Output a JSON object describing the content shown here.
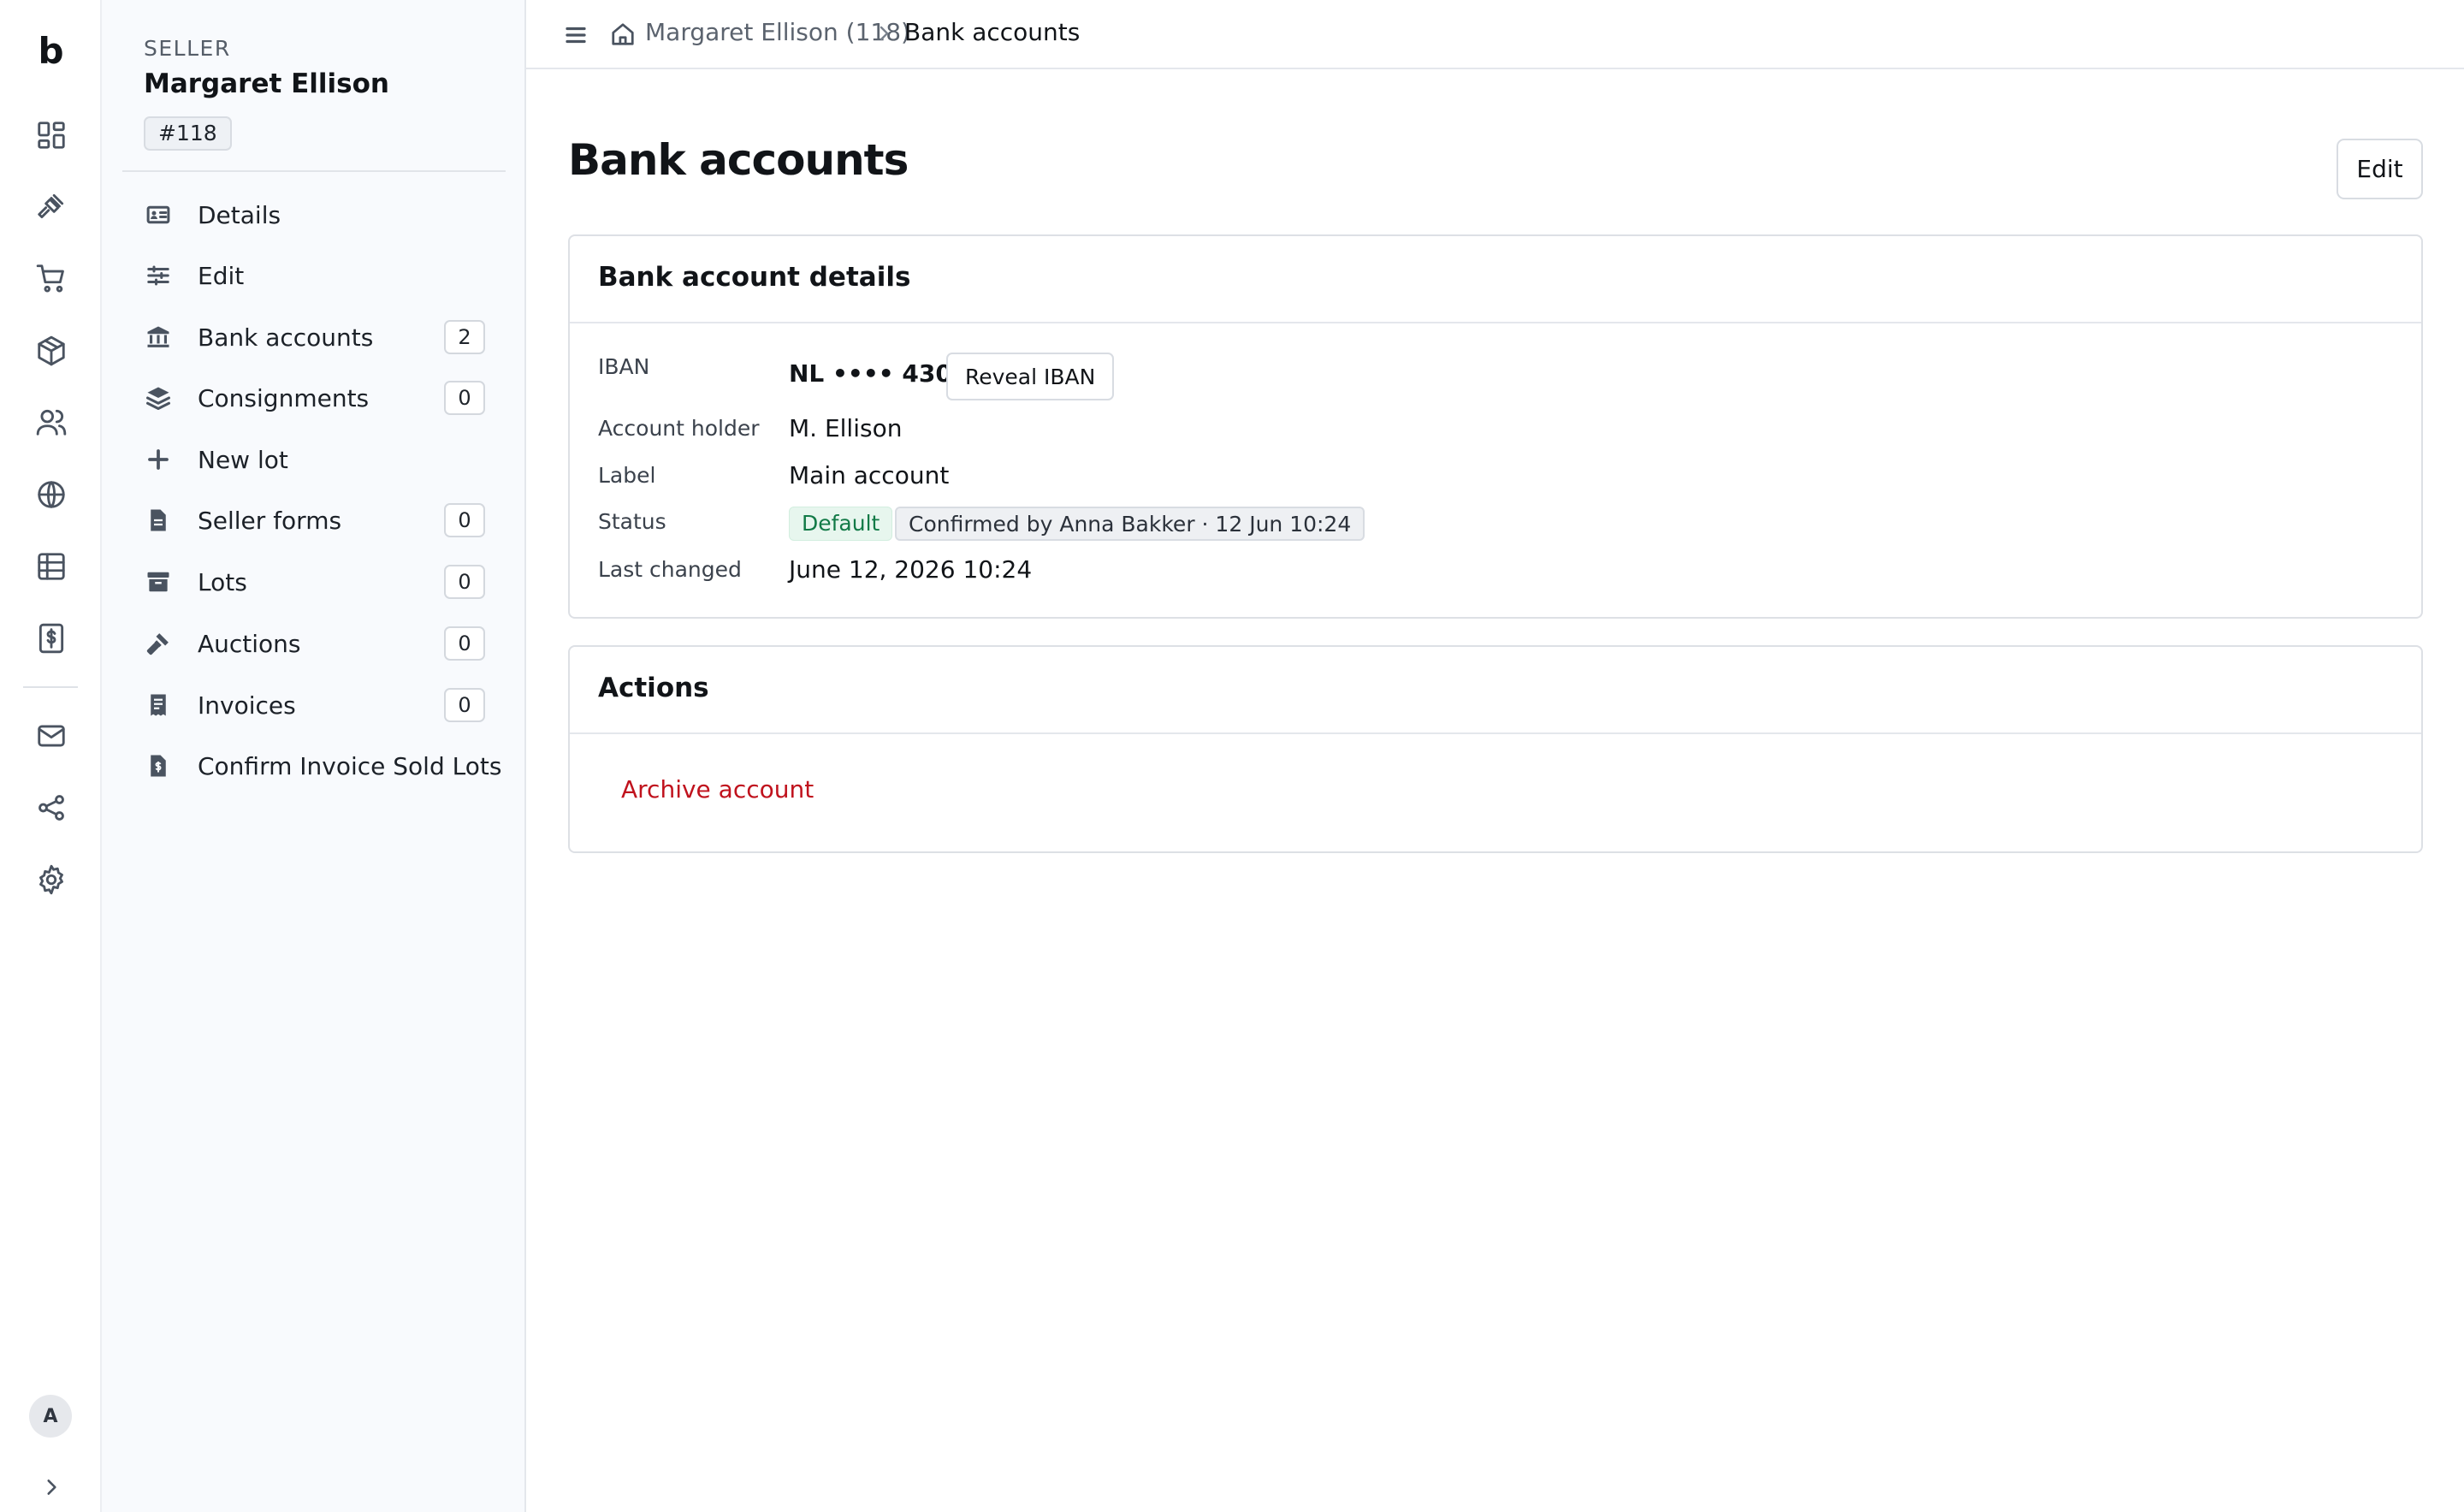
{
  "app": {
    "logo_letter": "b"
  },
  "rail": {
    "icons": [
      "dashboard-icon",
      "gavel-icon",
      "cart-icon",
      "package-icon",
      "users-icon",
      "globe-icon",
      "table-icon",
      "invoice-dollar-icon",
      "mail-icon",
      "share-icon",
      "gear-icon"
    ],
    "avatar_initial": "A"
  },
  "seller": {
    "eyebrow": "SELLER",
    "name": "Margaret Ellison",
    "id_badge": "#118"
  },
  "sidebar": {
    "items": [
      {
        "label": "Details",
        "count": null,
        "icon": "id-card-icon"
      },
      {
        "label": "Edit",
        "count": null,
        "icon": "sliders-icon"
      },
      {
        "label": "Bank accounts",
        "count": "2",
        "icon": "bank-icon"
      },
      {
        "label": "Consignments",
        "count": "0",
        "icon": "layers-icon"
      },
      {
        "label": "New lot",
        "count": null,
        "icon": "plus-icon"
      },
      {
        "label": "Seller forms",
        "count": "0",
        "icon": "file-icon"
      },
      {
        "label": "Lots",
        "count": "0",
        "icon": "archive-box-icon"
      },
      {
        "label": "Auctions",
        "count": "0",
        "icon": "gavel-icon"
      },
      {
        "label": "Invoices",
        "count": "0",
        "icon": "receipt-icon"
      },
      {
        "label": "Confirm Invoice Sold Lots",
        "count": null,
        "icon": "file-dollar-icon"
      }
    ]
  },
  "breadcrumb": {
    "parent": "Margaret Ellison (118)",
    "current": "Bank accounts"
  },
  "page": {
    "title": "Bank accounts",
    "edit_label": "Edit"
  },
  "details_card": {
    "title": "Bank account details",
    "iban_label": "IBAN",
    "iban_value": "NL •••• 4300",
    "reveal_label": "Reveal IBAN",
    "holder_label": "Account holder",
    "holder_value": "M. Ellison",
    "label_label": "Label",
    "label_value": "Main account",
    "status_label": "Status",
    "status_default": "Default",
    "status_confirmed": "Confirmed by Anna Bakker · 12 Jun 10:24",
    "changed_label": "Last changed",
    "changed_value": "June 12, 2026 10:24"
  },
  "actions_card": {
    "title": "Actions",
    "archive_label": "Archive account"
  },
  "colors": {
    "danger": "#c0121d",
    "success_text": "#127a47",
    "success_bg": "#e7f6ee",
    "sidebar_bg": "#f8fafd"
  }
}
